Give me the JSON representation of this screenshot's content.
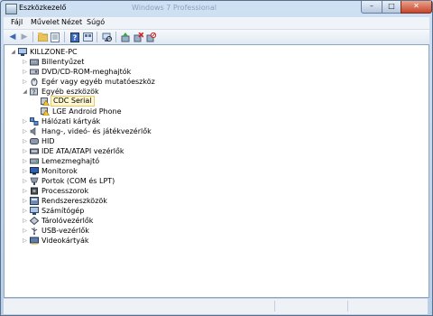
{
  "window": {
    "title": "Eszközkezelő",
    "background_title": "Windows 7 Professional"
  },
  "window_controls": {
    "minimize": "–",
    "maximize": "□",
    "close": "✕"
  },
  "menubar": {
    "items": [
      "Fájl",
      "Művelet",
      "Nézet",
      "Súgó"
    ]
  },
  "toolbar": {
    "back": "back-arrow",
    "forward": "forward-arrow",
    "up": "up-folder",
    "properties": "properties",
    "help": "help",
    "view": "view-toggle",
    "refresh": "scan-hardware",
    "update": "update-driver",
    "uninstall": "uninstall",
    "disable": "disable-device"
  },
  "tree": {
    "root": "KILLZONE-PC",
    "categories": [
      {
        "label": "Billentyűzet",
        "icon": "keyboard-icon",
        "expanded": false
      },
      {
        "label": "DVD/CD-ROM-meghajtók",
        "icon": "dvd-drive-icon",
        "expanded": false
      },
      {
        "label": "Egér vagy egyéb mutatóeszköz",
        "icon": "mouse-icon",
        "expanded": false
      },
      {
        "label": "Egyéb eszközök",
        "icon": "other-devices-icon",
        "expanded": true,
        "children": [
          {
            "label": "CDC Serial",
            "icon": "warning-device-icon",
            "selected": true
          },
          {
            "label": "LGE Android Phone",
            "icon": "warning-device-icon",
            "selected": false
          }
        ]
      },
      {
        "label": "Hálózati kártyák",
        "icon": "network-adapter-icon",
        "expanded": false
      },
      {
        "label": "Hang-, videó- és játékvezérlők",
        "icon": "sound-icon",
        "expanded": false
      },
      {
        "label": "HID",
        "icon": "hid-icon",
        "expanded": false
      },
      {
        "label": "IDE ATA/ATAPI vezérlők",
        "icon": "ide-controller-icon",
        "expanded": false
      },
      {
        "label": "Lemezmeghajtó",
        "icon": "disk-drive-icon",
        "expanded": false
      },
      {
        "label": "Monitorok",
        "icon": "monitor-icon",
        "expanded": false
      },
      {
        "label": "Portok (COM és LPT)",
        "icon": "port-icon",
        "expanded": false
      },
      {
        "label": "Processzorok",
        "icon": "processor-icon",
        "expanded": false
      },
      {
        "label": "Rendszereszközök",
        "icon": "system-device-icon",
        "expanded": false
      },
      {
        "label": "Számítógép",
        "icon": "computer-icon",
        "expanded": false
      },
      {
        "label": "Tárolóvezérlők",
        "icon": "storage-controller-icon",
        "expanded": false
      },
      {
        "label": "USB-vezérlők",
        "icon": "usb-icon",
        "expanded": false
      },
      {
        "label": "Videokártyák",
        "icon": "display-adapter-icon",
        "expanded": false
      }
    ]
  },
  "colors": {
    "selection_fill": "#fff7d1",
    "selection_border": "#e8c96b",
    "chrome": "#c9d9ec",
    "close_button": "#c7452d"
  }
}
